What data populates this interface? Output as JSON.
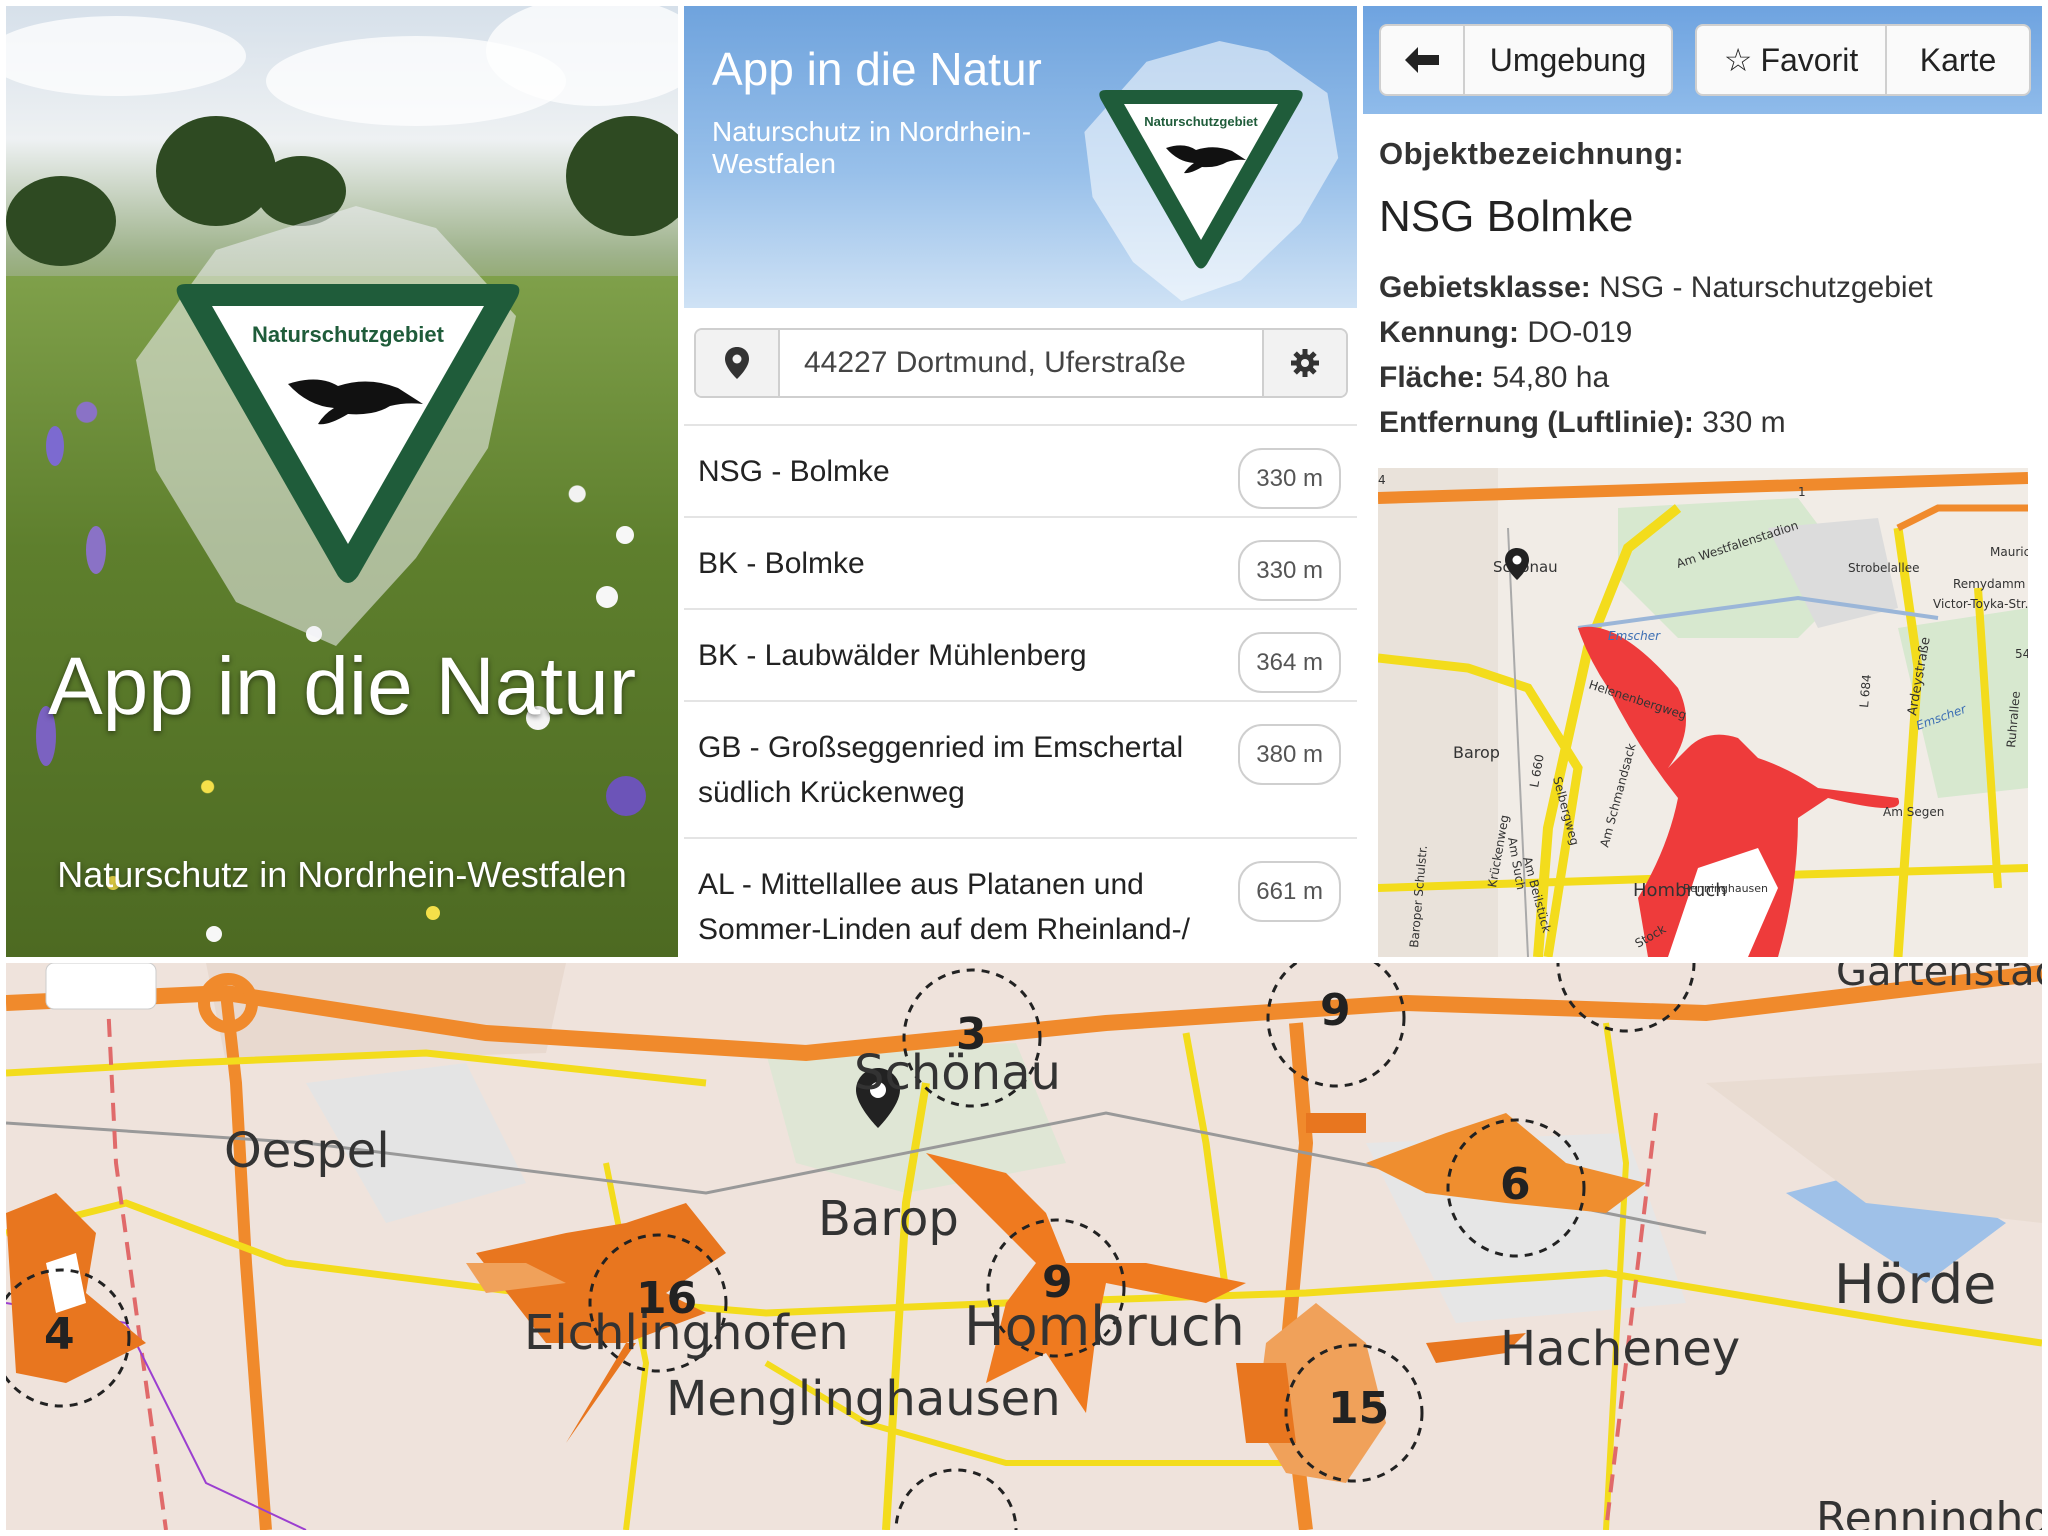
{
  "splash": {
    "sign_text": "Naturschutzgebiet",
    "title": "App in die Natur",
    "subtitle": "Naturschutz in Nordrhein-Westfalen"
  },
  "list_screen": {
    "banner": {
      "title": "App in die Natur",
      "subtitle": "Naturschutz in Nordrhein-Westfalen",
      "sign_text": "Naturschutzgebiet"
    },
    "search": {
      "location_icon": "map-pin-icon",
      "value": "44227 Dortmund, Uferstraße",
      "settings_icon": "gear-icon"
    },
    "items": [
      {
        "label": "NSG - Bolmke",
        "distance": "330 m"
      },
      {
        "label": "BK - Bolmke",
        "distance": "330 m"
      },
      {
        "label": "BK - Laubwälder Mühlenberg",
        "distance": "364 m"
      },
      {
        "label": "GB - Großseggenried im Emschertal südlich Krückenweg",
        "distance": "380 m"
      },
      {
        "label": "AL - Mittellallee aus Platanen und Sommer-Linden auf dem Rheinland-/",
        "distance": "661 m"
      }
    ]
  },
  "detail_screen": {
    "toolbar": {
      "back_icon": "arrow-left-icon",
      "umgebung": "Umgebung",
      "favorit": "Favorit",
      "favorit_icon": "star-outline-icon",
      "karte": "Karte"
    },
    "object_label": "Objektbezeichnung:",
    "object_name": "NSG Bolmke",
    "fields": [
      {
        "key": "Gebietsklasse:",
        "value": "NSG - Naturschutzgebiet"
      },
      {
        "key": "Kennung:",
        "value": "DO-019"
      },
      {
        "key": "Fläche:",
        "value": "54,80 ha"
      },
      {
        "key": "Entfernung (Luftlinie):",
        "value": "330 m"
      }
    ],
    "map_labels": {
      "schoenau": "Schönau",
      "barop": "Barop",
      "hombruch": "Hombruch",
      "emscher": "Emscher",
      "emscher2": "Emscher",
      "helenenbergweg": "Helenenbergweg",
      "am_westfalenstadion": "Am Westfalenstadion",
      "strobelallee": "Strobelallee",
      "ardeystrasse": "Ardeystraße",
      "am_segen": "Am Segen",
      "krueckenweg": "Krückenweg",
      "renninghausen": "Renninghausen",
      "remydamm": "Remydamm",
      "victor_toyka": "Victor-Toyka-Str.",
      "ruhrallee": "Ruhrallee",
      "l660": "L 660",
      "l684": "L 684",
      "b54": "54",
      "b1": "1",
      "a4": "4",
      "baroper_schulstr": "Baroper Schulstr.",
      "am_beilstueck": "Am Beilstück",
      "am_schmandsack": "Am Schmandsack",
      "selbergweg": "Selbergweg",
      "am_such": "Am Such",
      "maurice": "Maurice",
      "stockumer": "Stock"
    }
  },
  "overview_map": {
    "places": {
      "oespel": "Oespel",
      "schoenau": "Schönau",
      "barop": "Barop",
      "hombruch": "Hombruch",
      "eichlinghofen": "Eichlinghofen",
      "menglinghausen": "Menglinghausen",
      "hacheney": "Hacheney",
      "hoerde": "Hörde",
      "gartenstadt": "Gartenstadt",
      "renninghof": "Renninghof"
    },
    "clusters": [
      "3",
      "9",
      "6",
      "16",
      "9",
      "4",
      "15"
    ],
    "pin_icon": "map-pin-icon"
  },
  "colors": {
    "sign_green": "#1f5c3a",
    "area_red": "#ee3b3b",
    "cluster_orange": "#e8761f",
    "road_yellow": "#f3dc1c",
    "highway_orange": "#f08a2c",
    "banner_blue": "#7eaee4"
  }
}
